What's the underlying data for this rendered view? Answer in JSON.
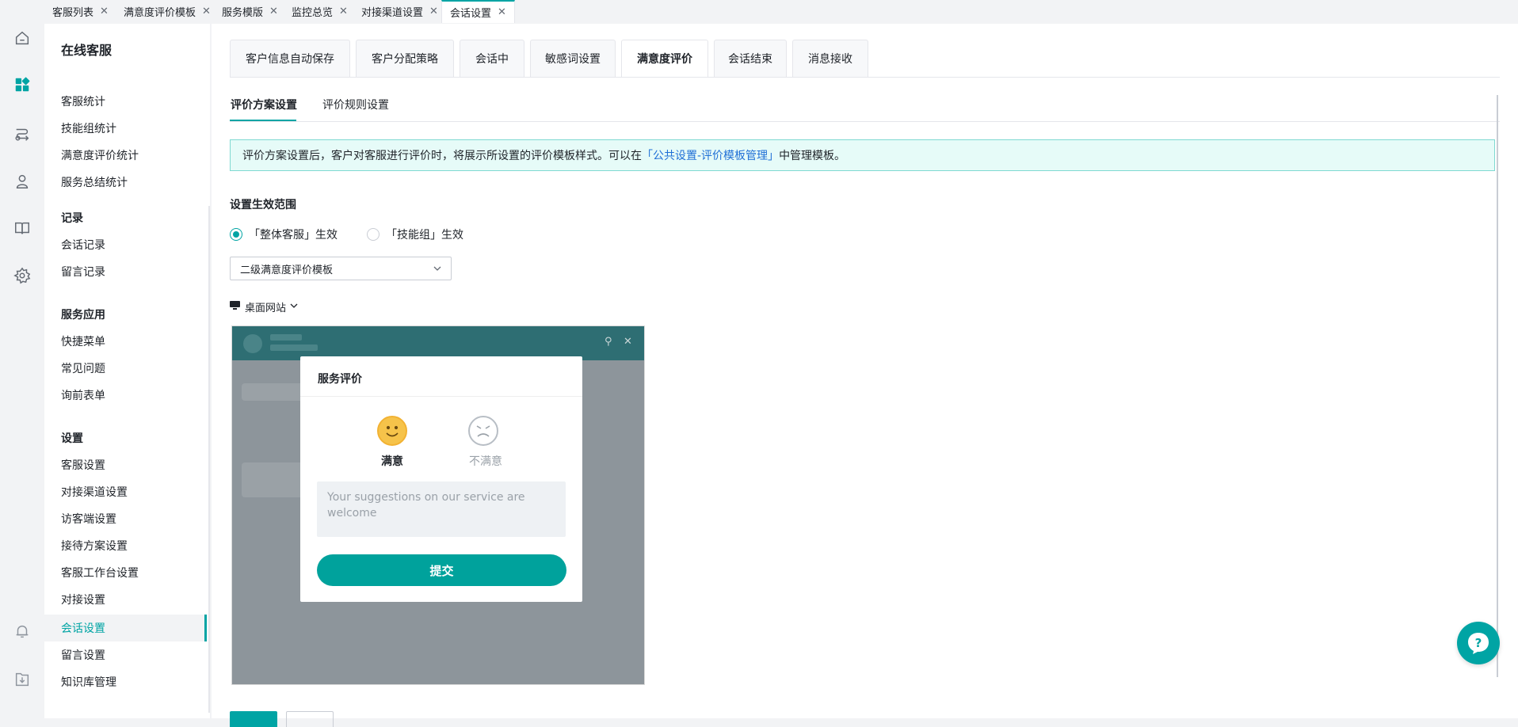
{
  "top_tabs": [
    {
      "label": "客服列表",
      "active": false
    },
    {
      "label": "满意度评价模板",
      "active": false
    },
    {
      "label": "服务模版",
      "active": false
    },
    {
      "label": "监控总览",
      "active": false
    },
    {
      "label": "对接渠道设置",
      "active": false
    },
    {
      "label": "会话设置",
      "active": true
    }
  ],
  "close_glyph": "✕",
  "rail_icons": [
    "home-icon",
    "dashboard-icon",
    "route-icon",
    "user-icon",
    "book-icon",
    "settings-icon",
    "bell-icon",
    "download-icon"
  ],
  "sidebar": {
    "title": "在线客服",
    "groups": [
      {
        "heading": "",
        "items": [
          "客服统计",
          "技能组统计",
          "满意度评价统计",
          "服务总结统计"
        ]
      },
      {
        "heading": "记录",
        "items": [
          "会话记录",
          "留言记录"
        ]
      },
      {
        "heading": "服务应用",
        "items": [
          "快捷菜单",
          "常见问题",
          "询前表单"
        ]
      },
      {
        "heading": "设置",
        "items": [
          "客服设置",
          "对接渠道设置",
          "访客端设置",
          "接待方案设置",
          "客服工作台设置",
          "对接设置",
          "会话设置",
          "留言设置",
          "知识库管理"
        ]
      }
    ],
    "active_item": "会话设置"
  },
  "settings_tabs": [
    "客户信息自动保存",
    "客户分配策略",
    "会话中",
    "敏感词设置",
    "满意度评价",
    "会话结束",
    "消息接收"
  ],
  "settings_active": "满意度评价",
  "sub_tabs": [
    "评价方案设置",
    "评价规则设置"
  ],
  "notice": {
    "before": "评价方案设置后，客户对客服进行评价时，将展示所设置的评价模板样式。可以在",
    "link": "「公共设置-评价模板管理」",
    "after": "中管理模板。"
  },
  "scope": {
    "label": "设置生效范围",
    "options": [
      "「整体客服」生效",
      "「技能组」生效"
    ],
    "selected": "「整体客服」生效"
  },
  "template_select": {
    "value": "二级满意度评价模板"
  },
  "device": {
    "label": "桌面网站"
  },
  "preview_modal": {
    "title": "服务评价",
    "satisfied": "满意",
    "unsatisfied": "不满意",
    "placeholder": "Your suggestions on our service are welcome",
    "submit": "提交"
  },
  "colors": {
    "accent": "#00a4a4",
    "link": "#1f6fd6",
    "notice_bg": "#e6fbf8"
  }
}
